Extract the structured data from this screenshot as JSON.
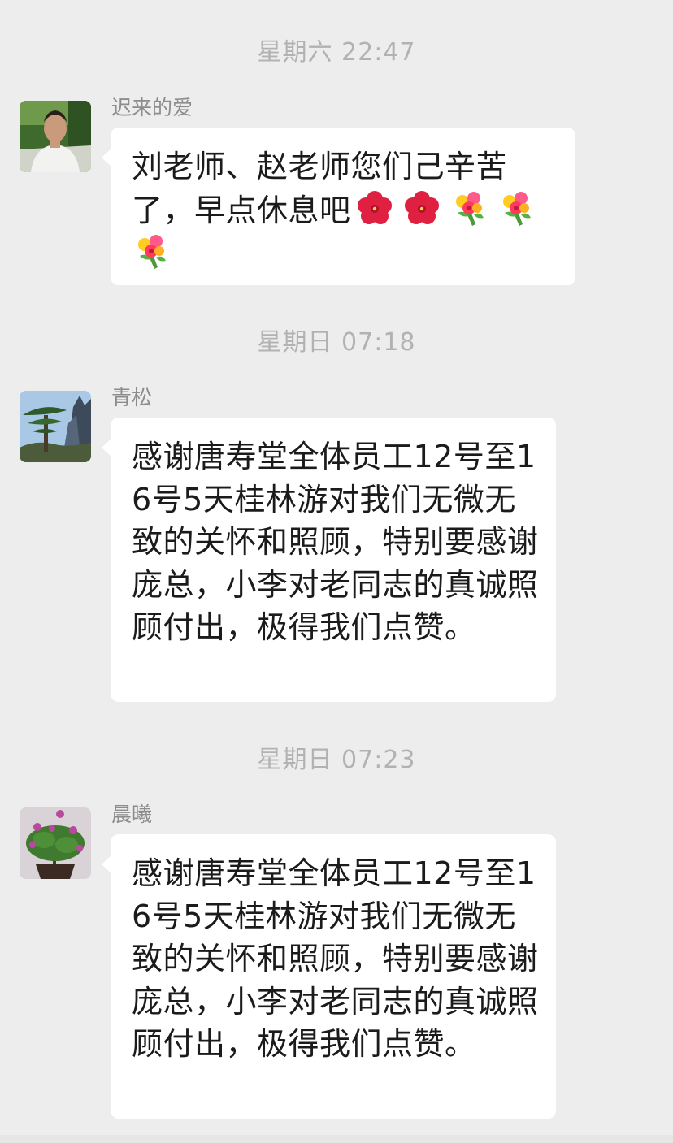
{
  "timestamps": [
    "星期六 22:47",
    "星期日 07:18",
    "星期日 07:23"
  ],
  "messages": [
    {
      "sender": "迟来的爱",
      "text_line1": "刘老师、赵老师您们己辛苦",
      "text_line2": "了，早点休息吧",
      "emojis": [
        "hibiscus-icon",
        "hibiscus-icon",
        "bouquet-icon",
        "bouquet-icon",
        "bouquet-icon"
      ]
    },
    {
      "sender": "青松",
      "text": "感谢唐寿堂全体员工12号至16号5天桂林游对我们无微无致的关怀和照顾，特别要感谢庞总，小李对老同志的真诚照顾付出，极得我们点赞。"
    },
    {
      "sender": "晨曦",
      "text": "感谢唐寿堂全体员工12号至16号5天桂林游对我们无微无致的关怀和照顾，特别要感谢庞总，小李对老同志的真诚照顾付出，极得我们点赞。"
    }
  ],
  "colors": {
    "background": "#ededed",
    "bubble": "#ffffff",
    "timestamp": "#b2b2b2",
    "sender": "#8c8c8c",
    "text": "#1b1b1b"
  }
}
